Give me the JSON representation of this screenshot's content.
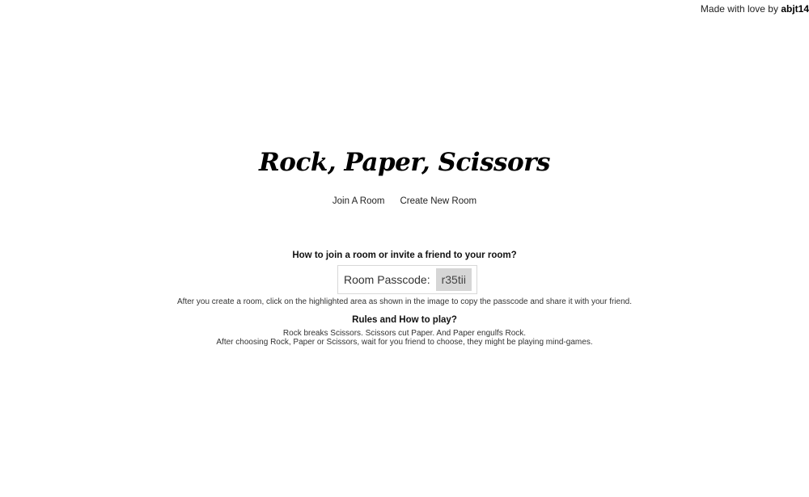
{
  "credit": {
    "prefix": "Made with love by",
    "author": "abjt14"
  },
  "title": "Rock, Paper, Scissors",
  "nav": {
    "join": "Join A Room",
    "create": "Create New Room"
  },
  "howto": {
    "heading": "How to join a room or invite a friend to your room?",
    "passcode_label": "Room Passcode:",
    "passcode_value": "r35tii",
    "description": "After you create a room, click on the highlighted area as shown in the image to copy the passcode and share it with your friend."
  },
  "rules": {
    "heading": "Rules and How to play?",
    "line1": "Rock breaks Scissors. Scissors cut Paper. And Paper engulfs Rock.",
    "line2": "After choosing Rock, Paper or Scissors, wait for you friend to choose, they might be playing mind-games."
  }
}
